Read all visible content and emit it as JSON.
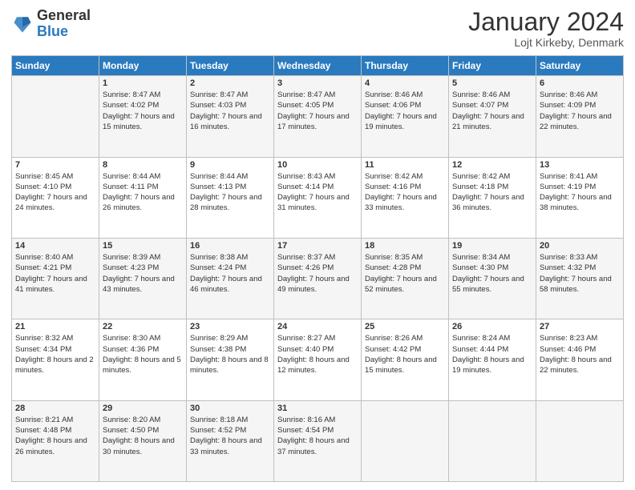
{
  "header": {
    "logo_line1": "General",
    "logo_line2": "Blue",
    "month": "January 2024",
    "location": "Lojt Kirkeby, Denmark"
  },
  "columns": [
    "Sunday",
    "Monday",
    "Tuesday",
    "Wednesday",
    "Thursday",
    "Friday",
    "Saturday"
  ],
  "weeks": [
    [
      {
        "day": "",
        "sunrise": "",
        "sunset": "",
        "daylight": ""
      },
      {
        "day": "1",
        "sunrise": "Sunrise: 8:47 AM",
        "sunset": "Sunset: 4:02 PM",
        "daylight": "Daylight: 7 hours and 15 minutes."
      },
      {
        "day": "2",
        "sunrise": "Sunrise: 8:47 AM",
        "sunset": "Sunset: 4:03 PM",
        "daylight": "Daylight: 7 hours and 16 minutes."
      },
      {
        "day": "3",
        "sunrise": "Sunrise: 8:47 AM",
        "sunset": "Sunset: 4:05 PM",
        "daylight": "Daylight: 7 hours and 17 minutes."
      },
      {
        "day": "4",
        "sunrise": "Sunrise: 8:46 AM",
        "sunset": "Sunset: 4:06 PM",
        "daylight": "Daylight: 7 hours and 19 minutes."
      },
      {
        "day": "5",
        "sunrise": "Sunrise: 8:46 AM",
        "sunset": "Sunset: 4:07 PM",
        "daylight": "Daylight: 7 hours and 21 minutes."
      },
      {
        "day": "6",
        "sunrise": "Sunrise: 8:46 AM",
        "sunset": "Sunset: 4:09 PM",
        "daylight": "Daylight: 7 hours and 22 minutes."
      }
    ],
    [
      {
        "day": "7",
        "sunrise": "Sunrise: 8:45 AM",
        "sunset": "Sunset: 4:10 PM",
        "daylight": "Daylight: 7 hours and 24 minutes."
      },
      {
        "day": "8",
        "sunrise": "Sunrise: 8:44 AM",
        "sunset": "Sunset: 4:11 PM",
        "daylight": "Daylight: 7 hours and 26 minutes."
      },
      {
        "day": "9",
        "sunrise": "Sunrise: 8:44 AM",
        "sunset": "Sunset: 4:13 PM",
        "daylight": "Daylight: 7 hours and 28 minutes."
      },
      {
        "day": "10",
        "sunrise": "Sunrise: 8:43 AM",
        "sunset": "Sunset: 4:14 PM",
        "daylight": "Daylight: 7 hours and 31 minutes."
      },
      {
        "day": "11",
        "sunrise": "Sunrise: 8:42 AM",
        "sunset": "Sunset: 4:16 PM",
        "daylight": "Daylight: 7 hours and 33 minutes."
      },
      {
        "day": "12",
        "sunrise": "Sunrise: 8:42 AM",
        "sunset": "Sunset: 4:18 PM",
        "daylight": "Daylight: 7 hours and 36 minutes."
      },
      {
        "day": "13",
        "sunrise": "Sunrise: 8:41 AM",
        "sunset": "Sunset: 4:19 PM",
        "daylight": "Daylight: 7 hours and 38 minutes."
      }
    ],
    [
      {
        "day": "14",
        "sunrise": "Sunrise: 8:40 AM",
        "sunset": "Sunset: 4:21 PM",
        "daylight": "Daylight: 7 hours and 41 minutes."
      },
      {
        "day": "15",
        "sunrise": "Sunrise: 8:39 AM",
        "sunset": "Sunset: 4:23 PM",
        "daylight": "Daylight: 7 hours and 43 minutes."
      },
      {
        "day": "16",
        "sunrise": "Sunrise: 8:38 AM",
        "sunset": "Sunset: 4:24 PM",
        "daylight": "Daylight: 7 hours and 46 minutes."
      },
      {
        "day": "17",
        "sunrise": "Sunrise: 8:37 AM",
        "sunset": "Sunset: 4:26 PM",
        "daylight": "Daylight: 7 hours and 49 minutes."
      },
      {
        "day": "18",
        "sunrise": "Sunrise: 8:35 AM",
        "sunset": "Sunset: 4:28 PM",
        "daylight": "Daylight: 7 hours and 52 minutes."
      },
      {
        "day": "19",
        "sunrise": "Sunrise: 8:34 AM",
        "sunset": "Sunset: 4:30 PM",
        "daylight": "Daylight: 7 hours and 55 minutes."
      },
      {
        "day": "20",
        "sunrise": "Sunrise: 8:33 AM",
        "sunset": "Sunset: 4:32 PM",
        "daylight": "Daylight: 7 hours and 58 minutes."
      }
    ],
    [
      {
        "day": "21",
        "sunrise": "Sunrise: 8:32 AM",
        "sunset": "Sunset: 4:34 PM",
        "daylight": "Daylight: 8 hours and 2 minutes."
      },
      {
        "day": "22",
        "sunrise": "Sunrise: 8:30 AM",
        "sunset": "Sunset: 4:36 PM",
        "daylight": "Daylight: 8 hours and 5 minutes."
      },
      {
        "day": "23",
        "sunrise": "Sunrise: 8:29 AM",
        "sunset": "Sunset: 4:38 PM",
        "daylight": "Daylight: 8 hours and 8 minutes."
      },
      {
        "day": "24",
        "sunrise": "Sunrise: 8:27 AM",
        "sunset": "Sunset: 4:40 PM",
        "daylight": "Daylight: 8 hours and 12 minutes."
      },
      {
        "day": "25",
        "sunrise": "Sunrise: 8:26 AM",
        "sunset": "Sunset: 4:42 PM",
        "daylight": "Daylight: 8 hours and 15 minutes."
      },
      {
        "day": "26",
        "sunrise": "Sunrise: 8:24 AM",
        "sunset": "Sunset: 4:44 PM",
        "daylight": "Daylight: 8 hours and 19 minutes."
      },
      {
        "day": "27",
        "sunrise": "Sunrise: 8:23 AM",
        "sunset": "Sunset: 4:46 PM",
        "daylight": "Daylight: 8 hours and 22 minutes."
      }
    ],
    [
      {
        "day": "28",
        "sunrise": "Sunrise: 8:21 AM",
        "sunset": "Sunset: 4:48 PM",
        "daylight": "Daylight: 8 hours and 26 minutes."
      },
      {
        "day": "29",
        "sunrise": "Sunrise: 8:20 AM",
        "sunset": "Sunset: 4:50 PM",
        "daylight": "Daylight: 8 hours and 30 minutes."
      },
      {
        "day": "30",
        "sunrise": "Sunrise: 8:18 AM",
        "sunset": "Sunset: 4:52 PM",
        "daylight": "Daylight: 8 hours and 33 minutes."
      },
      {
        "day": "31",
        "sunrise": "Sunrise: 8:16 AM",
        "sunset": "Sunset: 4:54 PM",
        "daylight": "Daylight: 8 hours and 37 minutes."
      },
      {
        "day": "",
        "sunrise": "",
        "sunset": "",
        "daylight": ""
      },
      {
        "day": "",
        "sunrise": "",
        "sunset": "",
        "daylight": ""
      },
      {
        "day": "",
        "sunrise": "",
        "sunset": "",
        "daylight": ""
      }
    ]
  ]
}
